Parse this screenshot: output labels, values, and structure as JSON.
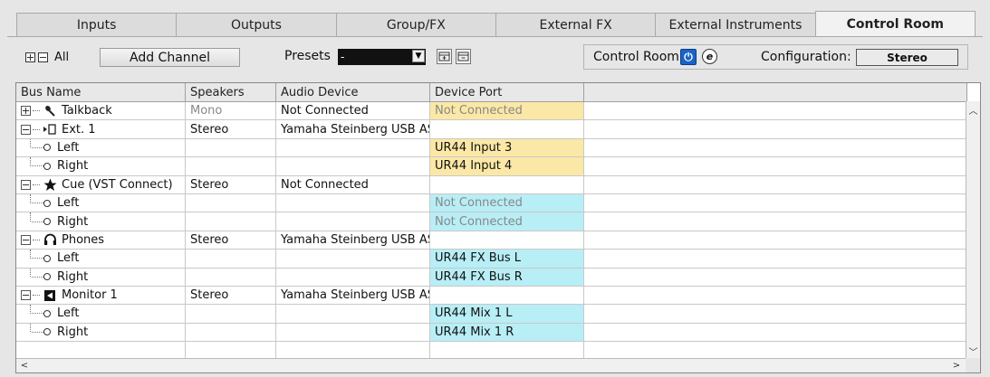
{
  "tabs": [
    "Inputs",
    "Outputs",
    "Group/FX",
    "External FX",
    "External Instruments",
    "Control Room"
  ],
  "active_tab": "Control Room",
  "toolbar": {
    "expand_all_label": "All",
    "add_channel_label": "Add Channel",
    "presets_label": "Presets",
    "presets_value": "-",
    "control_room_label": "Control Room:",
    "power_icon": "power-icon",
    "exclusive_icon": "e-icon",
    "configuration_label": "Configuration:",
    "configuration_value": "Stereo"
  },
  "columns": [
    "Bus Name",
    "Speakers",
    "Audio Device",
    "Device Port",
    ""
  ],
  "rows": [
    {
      "type": "bus",
      "expanded": false,
      "icon": "microphone-icon",
      "name": "Talkback",
      "speakers": "Mono",
      "device": "Not Connected",
      "port": "Not Connected",
      "port_color": "yellow",
      "speakers_grey": true,
      "port_grey": true
    },
    {
      "type": "bus",
      "expanded": true,
      "icon": "external-monitor-icon",
      "name": "Ext. 1",
      "speakers": "Stereo",
      "device": "Yamaha Steinberg USB AS",
      "port": "",
      "port_color": ""
    },
    {
      "type": "port",
      "name": "Left",
      "port": "UR44 Input 3",
      "port_color": "yellow"
    },
    {
      "type": "port",
      "name": "Right",
      "port": "UR44 Input 4",
      "port_color": "yellow"
    },
    {
      "type": "bus",
      "expanded": true,
      "icon": "star-icon",
      "name": "Cue (VST Connect)",
      "speakers": "Stereo",
      "device": "Not Connected",
      "port": "",
      "port_color": ""
    },
    {
      "type": "port",
      "name": "Left",
      "port": "Not Connected",
      "port_color": "cyan",
      "port_grey": true
    },
    {
      "type": "port",
      "name": "Right",
      "port": "Not Connected",
      "port_color": "cyan",
      "port_grey": true
    },
    {
      "type": "bus",
      "expanded": true,
      "icon": "headphones-icon",
      "name": "Phones",
      "speakers": "Stereo",
      "device": "Yamaha Steinberg USB AS",
      "port": "",
      "port_color": ""
    },
    {
      "type": "port",
      "name": "Left",
      "port": "UR44 FX Bus L",
      "port_color": "cyan"
    },
    {
      "type": "port",
      "name": "Right",
      "port": "UR44 FX Bus R",
      "port_color": "cyan"
    },
    {
      "type": "bus",
      "expanded": true,
      "icon": "speaker-icon",
      "name": "Monitor 1",
      "speakers": "Stereo",
      "device": "Yamaha Steinberg USB AS",
      "port": "",
      "port_color": ""
    },
    {
      "type": "port",
      "name": "Left",
      "port": "UR44 Mix 1 L",
      "port_color": "cyan"
    },
    {
      "type": "port",
      "name": "Right",
      "port": "UR44 Mix 1 R",
      "port_color": "cyan"
    },
    {
      "type": "empty"
    }
  ],
  "colors": {
    "yellow": "#fbe8a6",
    "cyan": "#b8eef6",
    "power_blue": "#1a63c7"
  }
}
